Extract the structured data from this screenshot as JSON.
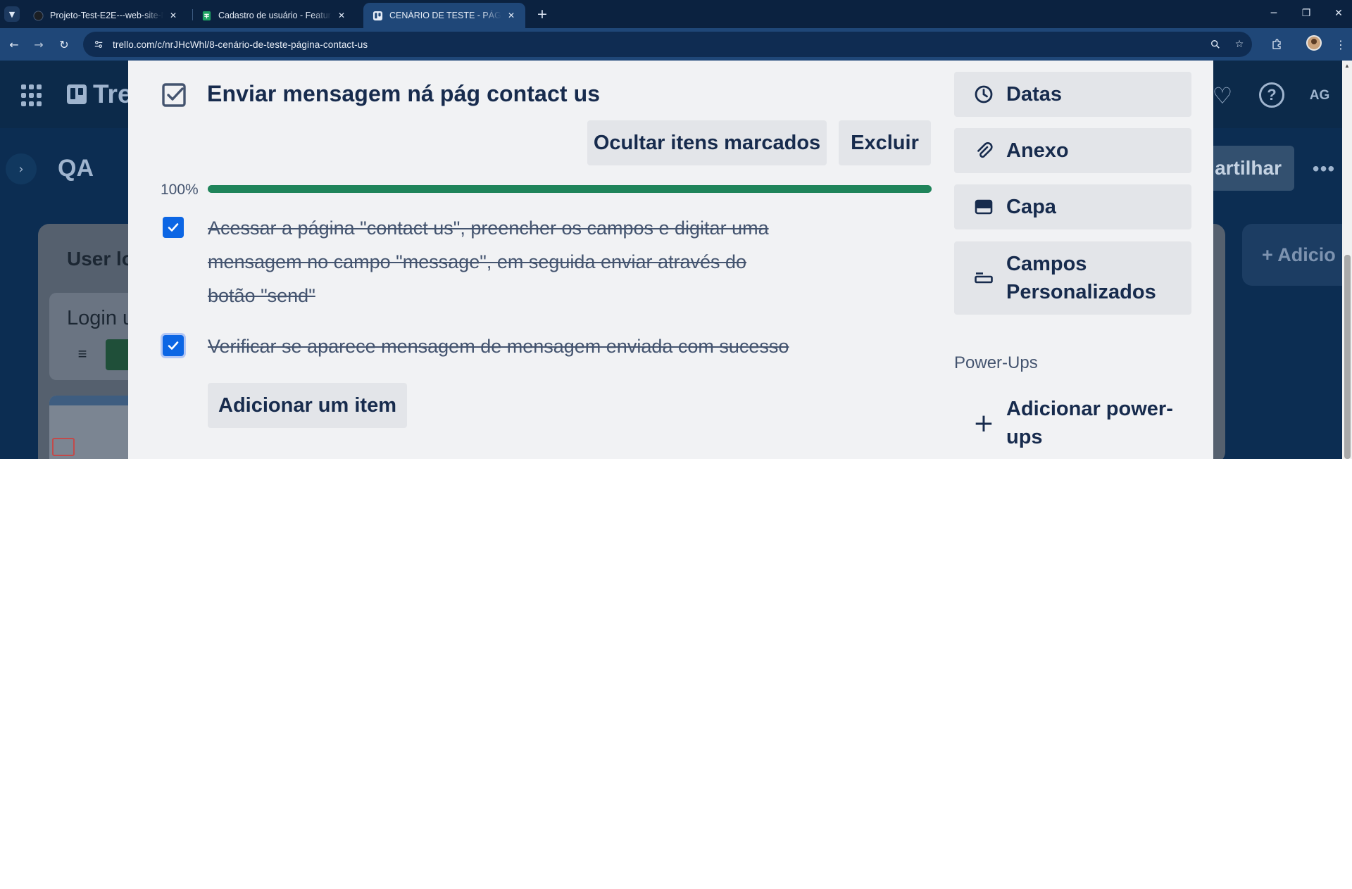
{
  "browser": {
    "tabs": [
      {
        "title": "Projeto-Test-E2E---web-site-My",
        "favicon": "github-icon"
      },
      {
        "title": "Cadastro de usuário - Feature -",
        "favicon": "sheets-icon"
      },
      {
        "title": "CENÁRIO DE TESTE - PÁGINA C",
        "favicon": "trello-icon",
        "active": true
      }
    ],
    "url": "trello.com/c/nrJHcWhl/8-cenário-de-teste-página-contact-us"
  },
  "trello": {
    "logo_text": "Tre",
    "avatar_initials": "AG",
    "board_title": "QA",
    "share_label": "artilhar",
    "list_title": "User lo",
    "card_title": "Login u",
    "add_list_label": "+ Adicio"
  },
  "checklist": {
    "title": "Enviar mensagem ná pág contact us",
    "hide_checked_label": "Ocultar itens marcados",
    "delete_label": "Excluir",
    "progress_label": "100%",
    "progress_value": 1.0,
    "items": [
      {
        "text": "Acessar a página \"contact us\", preencher os campos e digitar uma mensagem no campo \"message\", em seguida enviar através do botão \"send\"",
        "checked": true
      },
      {
        "text": "Verificar se aparece mensagem de mensagem enviada com sucesso",
        "checked": true
      }
    ],
    "add_item_label": "Adicionar um item"
  },
  "sidebar": {
    "buttons": [
      {
        "label": "Datas",
        "icon": "clock-icon"
      },
      {
        "label": "Anexo",
        "icon": "paperclip-icon"
      },
      {
        "label": "Capa",
        "icon": "cover-icon"
      },
      {
        "label": "Campos Personalizados",
        "icon": "custom-fields-icon"
      }
    ],
    "powerups_heading": "Power-Ups",
    "add_powerups_label": "Adicionar power-ups"
  },
  "colors": {
    "progress_fill": "#1f845a",
    "checkbox": "#0c66e4",
    "chrome_dark": "#0b2240",
    "chrome_toolbar": "#1f4778"
  }
}
